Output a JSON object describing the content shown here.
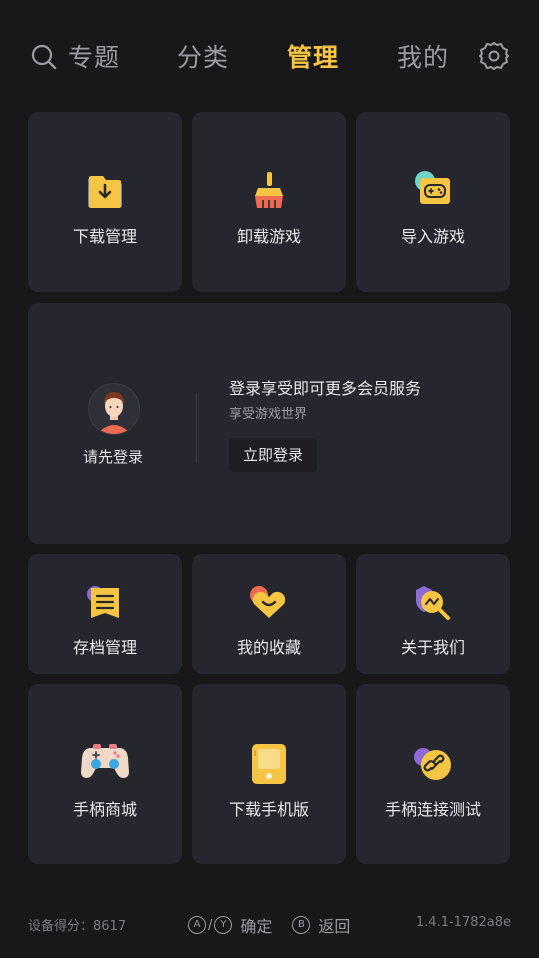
{
  "nav": {
    "tabs": [
      "专题",
      "分类",
      "管理",
      "我的"
    ],
    "active_tab": "管理",
    "search_icon": "search-icon",
    "settings_icon": "gear-icon"
  },
  "top_cards": [
    {
      "label": "下载管理",
      "icon": "download-folder-icon"
    },
    {
      "label": "卸载游戏",
      "icon": "broom-icon"
    },
    {
      "label": "导入游戏",
      "icon": "gamepad-import-icon"
    }
  ],
  "login": {
    "prompt": "请先登录",
    "promo_title": "登录享受即可更多会员服务",
    "promo_sub": "享受游戏世界",
    "button": "立即登录"
  },
  "mid_cards": [
    {
      "label": "存档管理",
      "icon": "save-file-icon"
    },
    {
      "label": "我的收藏",
      "icon": "heart-favorite-icon"
    },
    {
      "label": "关于我们",
      "icon": "about-search-icon"
    }
  ],
  "bottom_cards": [
    {
      "label": "手柄商城",
      "icon": "gamepad-shop-icon"
    },
    {
      "label": "下载手机版",
      "icon": "phone-download-icon"
    },
    {
      "label": "手柄连接测试",
      "icon": "link-test-icon"
    }
  ],
  "footer": {
    "score": "设备得分：8617",
    "key_a": "A",
    "key_y": "Y",
    "confirm": "确定",
    "key_b": "B",
    "back": "返回",
    "version": "1.4.1-1782a8e"
  },
  "colors": {
    "background": "#18181b",
    "card": "#26262e",
    "accent": "#f6c544",
    "muted_text": "#9b9ba1"
  }
}
